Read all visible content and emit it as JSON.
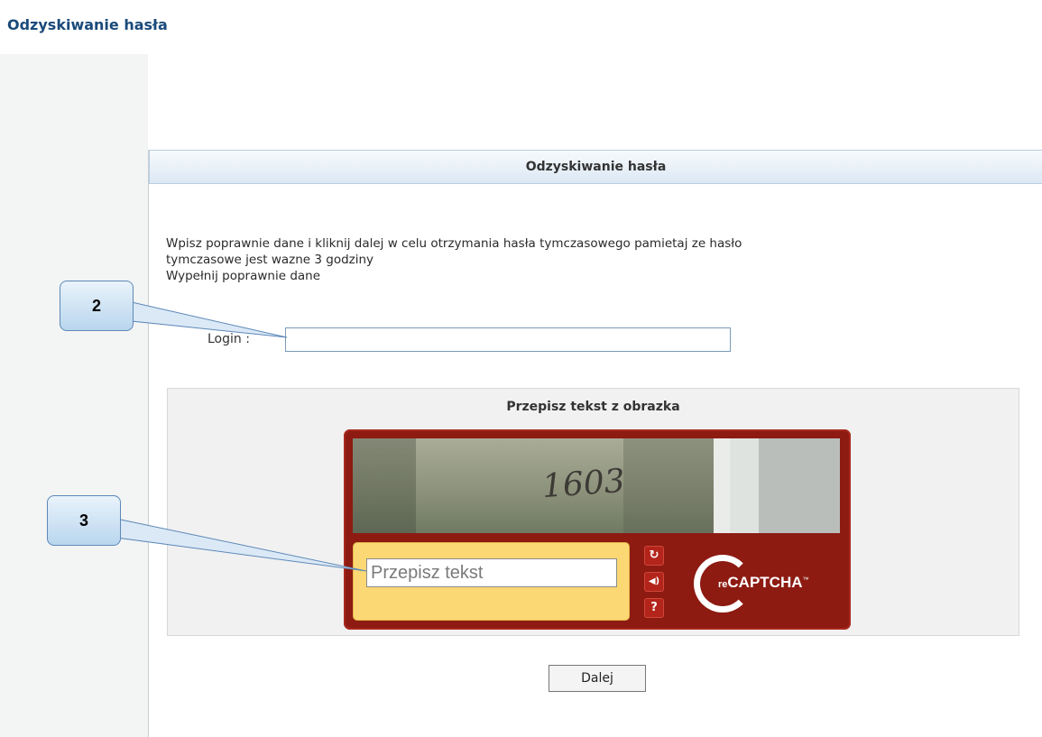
{
  "page": {
    "title": "Odzyskiwanie hasła"
  },
  "panel": {
    "header": "Odzyskiwanie hasła",
    "instructions": [
      "Wpisz poprawnie dane i kliknij dalej w celu otrzymania hasła tymczasowego pamietaj ze hasło",
      "tymczasowe jest wazne 3 godziny",
      "Wypełnij poprawnie dane"
    ],
    "login": {
      "label": "Login :",
      "value": ""
    }
  },
  "captcha": {
    "title": "Przepisz tekst z obrazka",
    "image_text": "1603",
    "input_placeholder": "Przepisz tekst",
    "buttons": [
      {
        "name": "reload-icon",
        "glyph": "↻"
      },
      {
        "name": "audio-icon",
        "glyph": "◀)"
      },
      {
        "name": "help-icon",
        "glyph": "?"
      }
    ],
    "logo": {
      "re": "re",
      "brand": "CAPTCHA",
      "tm": "™"
    }
  },
  "actions": {
    "next_label": "Dalej"
  },
  "callouts": [
    {
      "label": "2"
    },
    {
      "label": "3"
    }
  ],
  "colors": {
    "accent": "#1a4a7a",
    "recaptcha_red": "#8d1b12",
    "recaptcha_yellow": "#fcd874"
  }
}
